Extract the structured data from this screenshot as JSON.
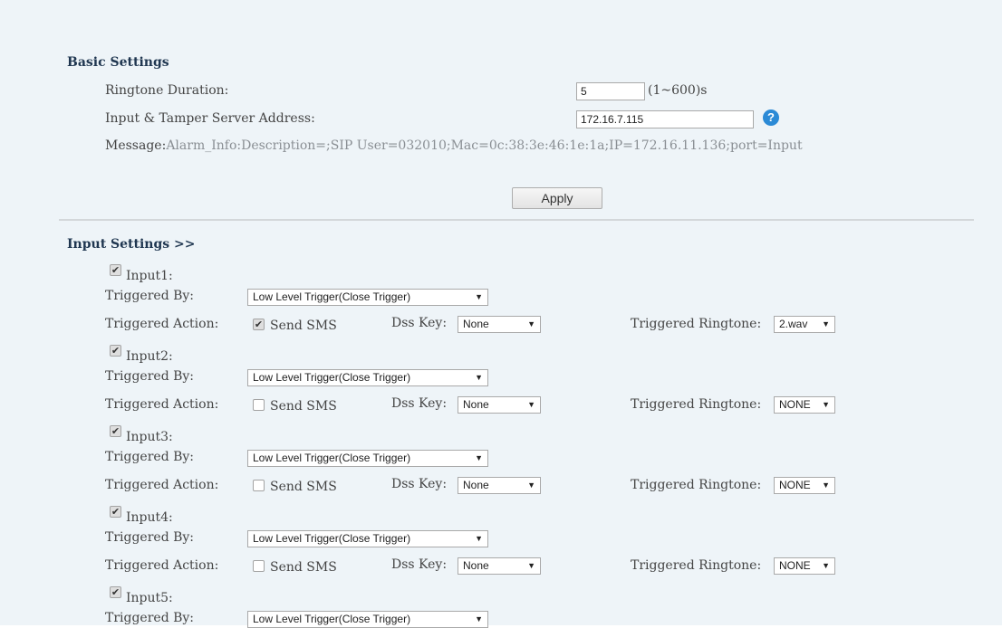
{
  "basic": {
    "title": "Basic Settings",
    "ringtone_duration_label": "Ringtone Duration:",
    "ringtone_duration_value": "5",
    "ringtone_duration_range": "(1~600)s",
    "server_address_label": "Input & Tamper Server Address:",
    "server_address_value": "172.16.7.115",
    "help_glyph": "?",
    "message_label": "Message:",
    "message_value": "Alarm_Info:Description=;SIP User=032010;Mac=0c:38:3e:46:1e:1a;IP=172.16.11.136;port=Input",
    "apply_label": "Apply"
  },
  "input_settings": {
    "title": "Input Settings >>",
    "triggered_by_label": "Triggered By:",
    "triggered_action_label": "Triggered Action:",
    "send_sms_label": "Send SMS",
    "dss_key_label": "Dss Key:",
    "triggered_ringtone_label": "Triggered Ringtone:",
    "arrow": "▼",
    "check_glyph": "✔",
    "inputs": [
      {
        "name": "Input1:",
        "enabled": true,
        "trigger": "Low Level Trigger(Close Trigger)",
        "send_sms": true,
        "dss_key": "None",
        "ringtone": "2.wav"
      },
      {
        "name": "Input2:",
        "enabled": true,
        "trigger": "Low Level Trigger(Close Trigger)",
        "send_sms": false,
        "dss_key": "None",
        "ringtone": "NONE"
      },
      {
        "name": "Input3:",
        "enabled": true,
        "trigger": "Low Level Trigger(Close Trigger)",
        "send_sms": false,
        "dss_key": "None",
        "ringtone": "NONE"
      },
      {
        "name": "Input4:",
        "enabled": true,
        "trigger": "Low Level Trigger(Close Trigger)",
        "send_sms": false,
        "dss_key": "None",
        "ringtone": "NONE"
      },
      {
        "name": "Input5:",
        "enabled": true,
        "trigger": "Low Level Trigger(Close Trigger)"
      }
    ]
  }
}
